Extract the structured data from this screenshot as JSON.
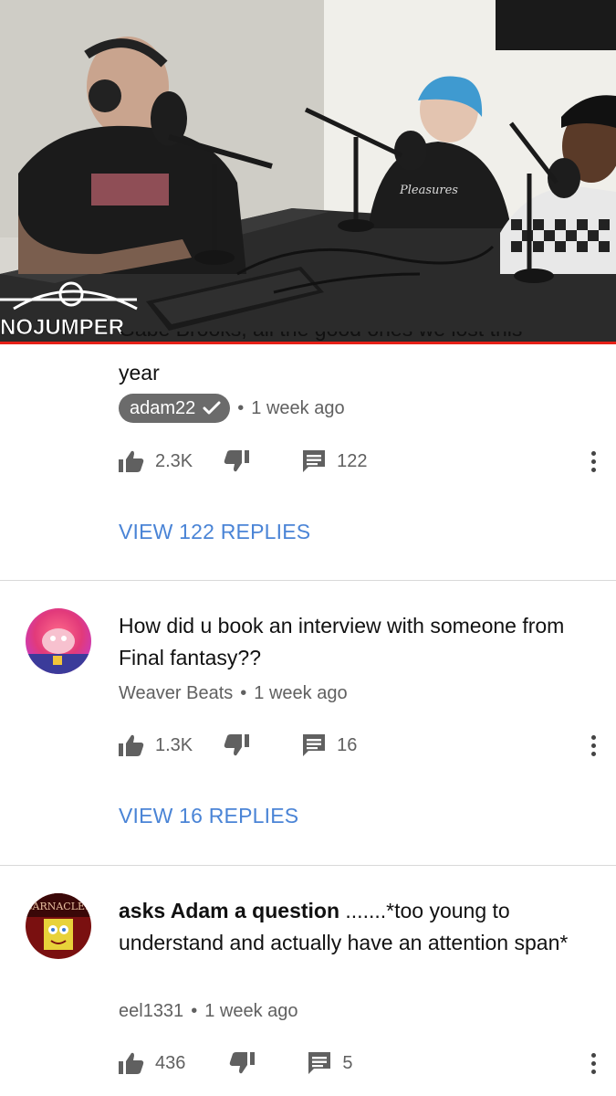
{
  "video": {
    "channel_logo": "NOJUMPER",
    "shirt_text": "Pleasures",
    "progress_percent": 100
  },
  "colors": {
    "accent_link": "#4a84d6",
    "progress": "#e62117",
    "owner_chip": "#6b6b6b"
  },
  "comments": [
    {
      "text_partial_hidden": "Gabe Brooks, all the good ones we lost this",
      "text_visible": "year",
      "author": "adam22",
      "is_owner": true,
      "time": "1 week ago",
      "likes": "2.3K",
      "replies": "122",
      "view_replies": "VIEW 122 REPLIES"
    },
    {
      "text": "How did u book an interview with someone from Final fantasy??",
      "author": "Weaver Beats",
      "time": "1 week ago",
      "likes": "1.3K",
      "replies": "16",
      "view_replies": "VIEW 16 REPLIES"
    },
    {
      "text_bold": "asks Adam a question",
      "text_rest": " .......*too young to understand and actually have an attention span*",
      "author": "eel1331",
      "time": "1 week ago",
      "likes": "436",
      "replies": "5",
      "avatar_text": "BARNACLES"
    }
  ],
  "icons": {
    "like": "thumbs-up-icon",
    "dislike": "thumbs-down-icon",
    "reply": "comment-icon",
    "more": "more-vert-icon",
    "verified": "checkmark-icon"
  }
}
